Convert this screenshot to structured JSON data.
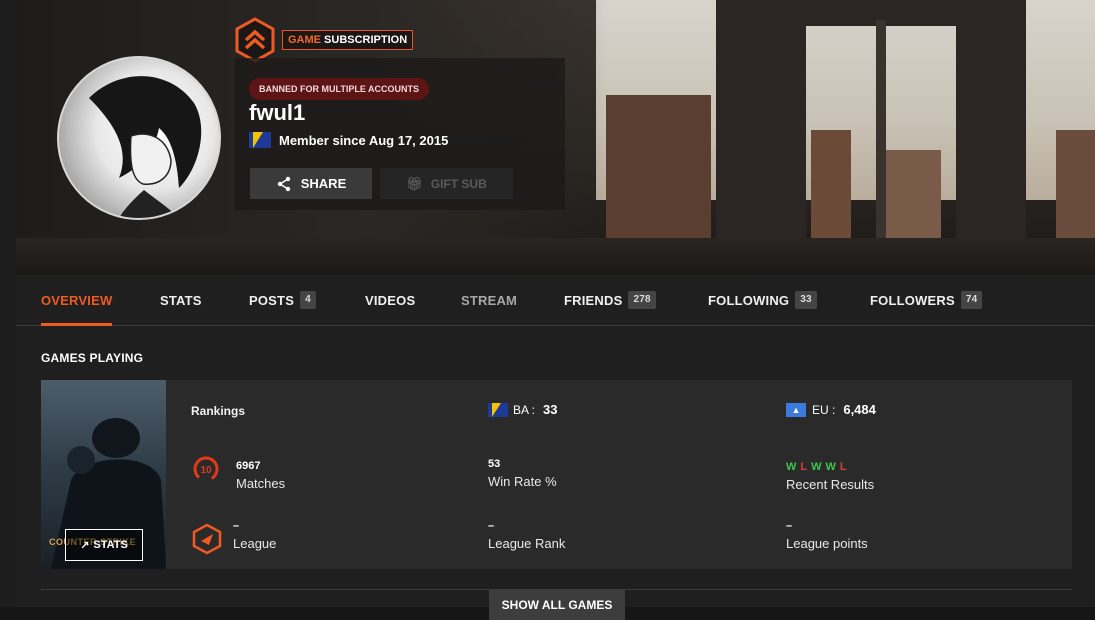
{
  "profile": {
    "subscription_label_game": "GAME",
    "subscription_label_rest": " SUBSCRIPTION",
    "banned_badge": "BANNED FOR MULTIPLE ACCOUNTS",
    "username": "fwul1",
    "member_since": "Member since Aug 17, 2015",
    "country_flag": "bosnia-flag-icon",
    "share_label": "SHARE",
    "gift_label": "GIFT SUB"
  },
  "tabs": [
    {
      "label": "OVERVIEW",
      "active": true
    },
    {
      "label": "STATS"
    },
    {
      "label": "POSTS",
      "count": "4"
    },
    {
      "label": "VIDEOS"
    },
    {
      "label": "STREAM"
    },
    {
      "label": "FRIENDS",
      "count": "278"
    },
    {
      "label": "FOLLOWING",
      "count": "33"
    },
    {
      "label": "FOLLOWERS",
      "count": "74"
    }
  ],
  "games": {
    "title": "GAMES PLAYING",
    "stats_button": "STATS",
    "cover_logo": "COUNTER STRIKE",
    "rankings_label": "Rankings",
    "country_rank_code": "BA :",
    "country_rank_value": "33",
    "region_rank_code": "EU :",
    "region_rank_value": "6,484",
    "matches_value": "6967",
    "matches_label": "Matches",
    "skill_level": "10",
    "winrate_value": "53",
    "winrate_label": "Win Rate %",
    "recent_results": [
      "W",
      "L",
      "W",
      "W",
      "L"
    ],
    "recent_label": "Recent Results",
    "league_value": "–",
    "league_label": "League",
    "league_rank_value": "–",
    "league_rank_label": "League Rank",
    "league_points_value": "–",
    "league_points_label": "League points",
    "show_all": "SHOW ALL GAMES"
  },
  "colors": {
    "accent": "#ef5a23",
    "win": "#3fc54a",
    "loss": "#e03a3a"
  }
}
